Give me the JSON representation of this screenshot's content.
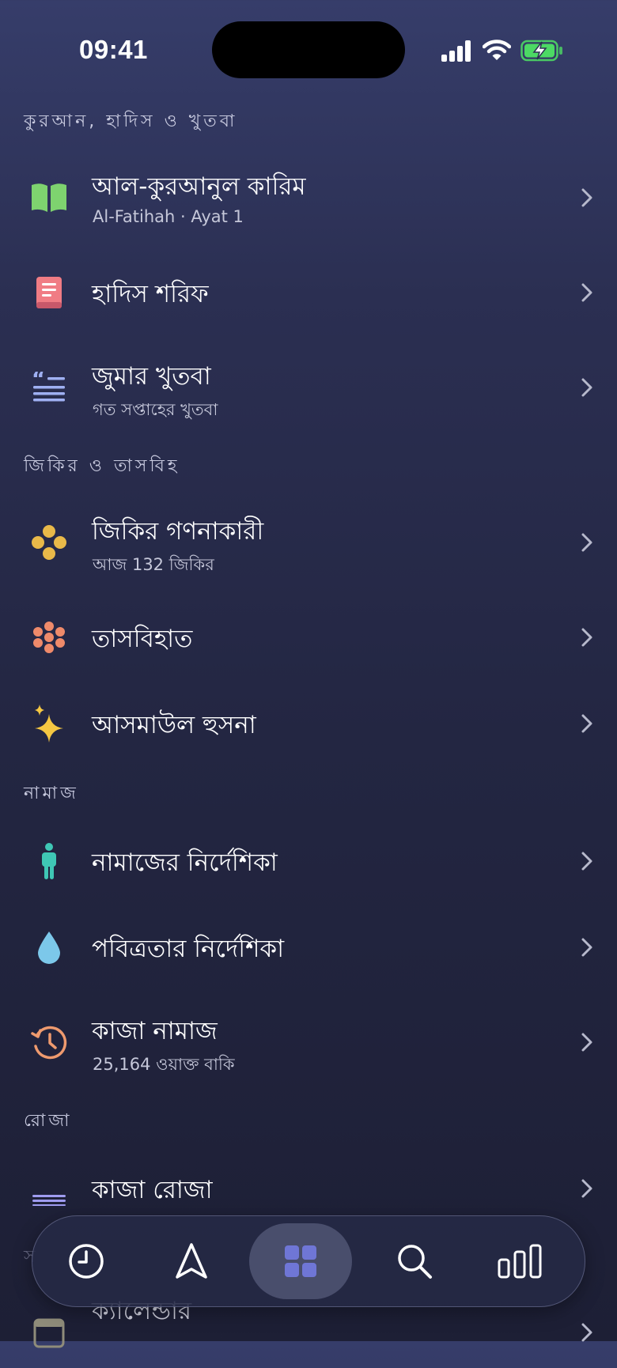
{
  "status_bar": {
    "time": "09:41"
  },
  "sections": {
    "quran": "কুরআন, হাদিস ও খুতবা",
    "zikr": "জিকির ও তাসবিহ",
    "namaz": "নামাজ",
    "roza": "রোজা"
  },
  "items": {
    "quran": {
      "title": "আল-কুরআনুল কারিম",
      "subtitle": "Al-Fatihah · Ayat 1",
      "icon": "open-book-icon",
      "color": "#7ed36f"
    },
    "hadith": {
      "title": "হাদিস শরিফ",
      "icon": "book-icon",
      "color": "#f07c84"
    },
    "khutba": {
      "title": "জুমার খুতবা",
      "subtitle": "গত সপ্তাহের খুতবা",
      "icon": "quote-text-icon",
      "color": "#9fb0f2"
    },
    "zikr_counter": {
      "title": "জিকির গণনাকারী",
      "subtitle": "আজ 132 জিকির",
      "icon": "beads-icon",
      "color": "#e9b949"
    },
    "tasbihat": {
      "title": "তাসবিহাত",
      "icon": "flower-beads-icon",
      "color": "#ef8a6a"
    },
    "asmaul_husna": {
      "title": "আসমাউল হুসনা",
      "icon": "sparkles-icon",
      "color": "#f5c742"
    },
    "namaz_guide": {
      "title": "নামাজের নির্দেশিকা",
      "icon": "person-standing-icon",
      "color": "#3fc7b5"
    },
    "purity_guide": {
      "title": "পবিত্রতার নির্দেশিকা",
      "icon": "water-drop-icon",
      "color": "#7cc8ea"
    },
    "qaza_namaz": {
      "title": "কাজা নামাজ",
      "subtitle": "25,164 ওয়াক্ত বাকি",
      "icon": "history-clock-icon",
      "color": "#ef9a6e"
    },
    "qaza_roza": {
      "title": "কাজা রোজা",
      "icon": "moon-haze-icon",
      "color": "#9f9cf0"
    },
    "calendar": {
      "title": "ক্যালেন্ডার",
      "icon": "calendar-icon"
    }
  },
  "partial_section": "স",
  "tabbar": {
    "tabs": [
      {
        "icon": "clock-icon"
      },
      {
        "icon": "compass-arrow-icon"
      },
      {
        "icon": "grid-icon",
        "active": true
      },
      {
        "icon": "search-icon"
      },
      {
        "icon": "bar-chart-icon"
      }
    ],
    "active_color": "#6f76d6"
  }
}
